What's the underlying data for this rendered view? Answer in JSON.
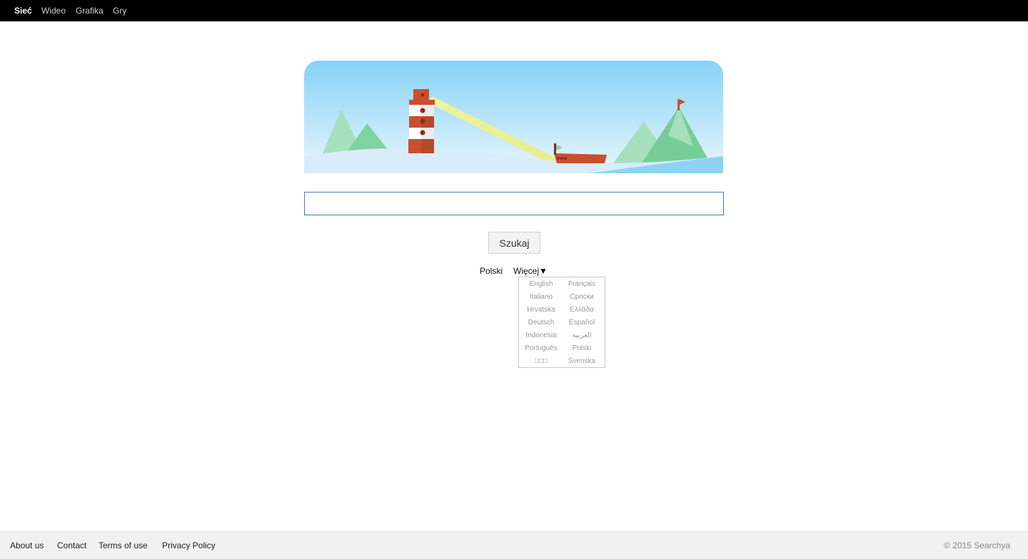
{
  "topnav": {
    "items": [
      {
        "label": "Sieć",
        "active": true
      },
      {
        "label": "Wideo",
        "active": false
      },
      {
        "label": "Grafika",
        "active": false
      },
      {
        "label": "Gry",
        "active": false
      }
    ]
  },
  "banner": {
    "illustration": "lighthouse-sea-boat-mountains"
  },
  "search": {
    "value": "",
    "placeholder": "",
    "button_label": "Szukaj"
  },
  "language": {
    "current": "Polski",
    "more_label": "Więcej▼",
    "options": [
      "English",
      "Français",
      "Italiano",
      "Српски",
      "Hrvatska",
      "Ελλάδα",
      "Deutsch",
      "Español",
      "Indonesia",
      "العربية",
      "Português",
      "Polski",
      "□□□",
      "Svenska"
    ]
  },
  "footer": {
    "links": [
      "About us",
      "Contact",
      "Terms of use",
      "Privacy Policy"
    ],
    "copyright": "© 2015 Searchya"
  },
  "colors": {
    "topbar_bg": "#000000",
    "input_border": "#3b7fb0",
    "footer_bg": "#f1f1f1",
    "sky_top": "#86d2f6",
    "lighthouse_red": "#c8502e"
  }
}
